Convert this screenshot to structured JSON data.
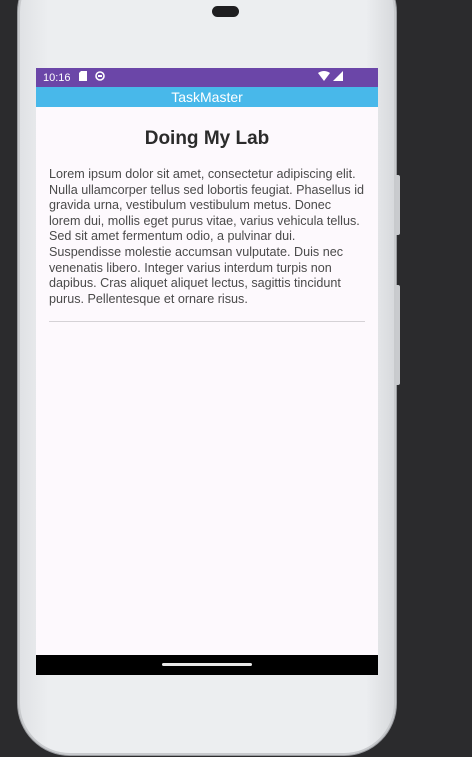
{
  "status_bar": {
    "time": "10:16",
    "icons": [
      "sd-card-icon",
      "notification-icon",
      "wifi-icon",
      "signal-icon"
    ]
  },
  "app_bar": {
    "title": "TaskMaster"
  },
  "task": {
    "title": "Doing My Lab",
    "body": "Lorem ipsum dolor sit amet, consectetur adipiscing elit. Nulla ullamcorper tellus sed lobortis feugiat. Phasellus id gravida urna, vestibulum vestibulum metus. Donec lorem dui, mollis eget purus vitae, varius vehicula tellus. Sed sit amet fermentum odio, a pulvinar dui. Suspendisse molestie accumsan vulputate. Duis nec venenatis libero. Integer varius interdum turpis non dapibus. Cras aliquet aliquet lectus, sagittis tincidunt purus. Pellentesque et ornare risus."
  },
  "colors": {
    "status_bar": "#6b46a8",
    "app_bar": "#48b8ea",
    "screen_bg": "#fdf9fd"
  }
}
